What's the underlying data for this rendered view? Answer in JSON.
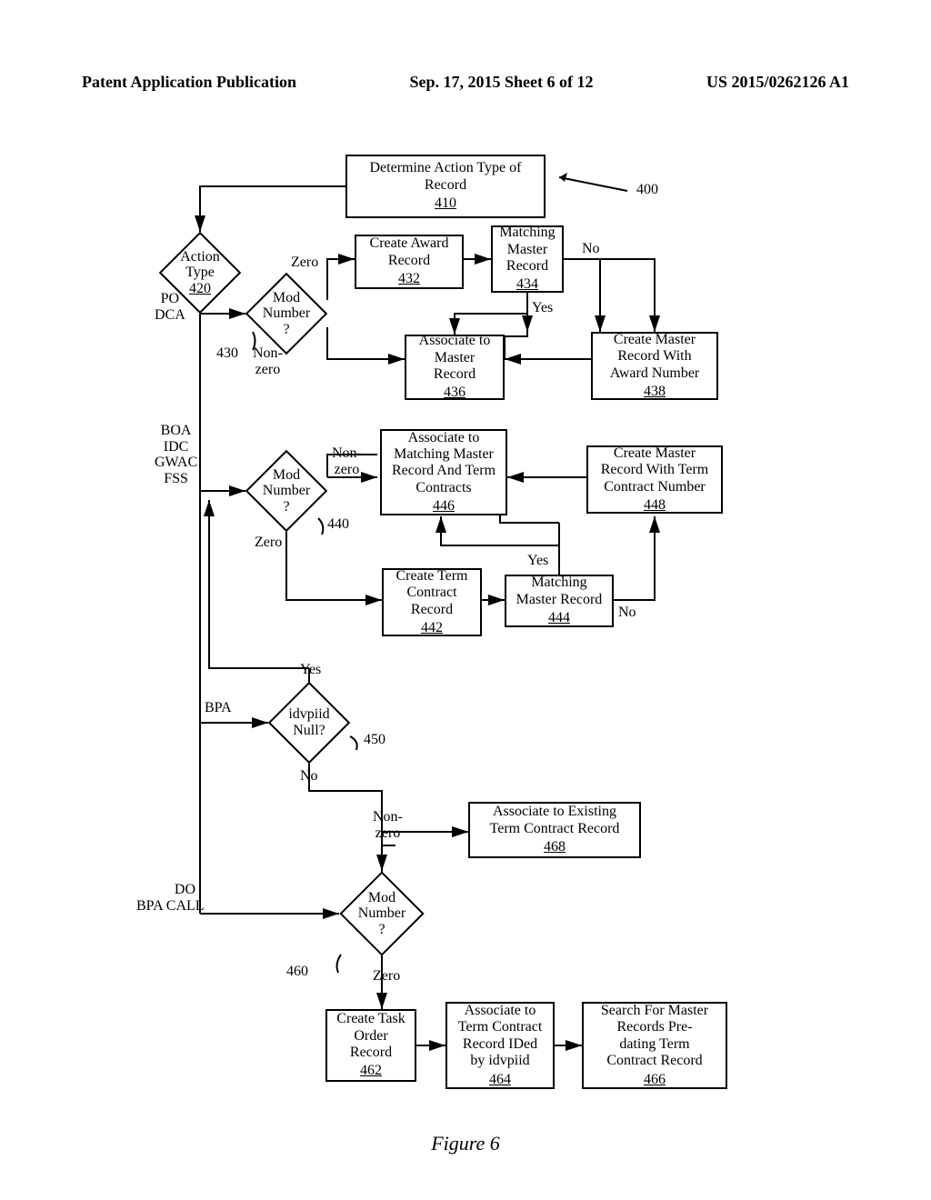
{
  "header": {
    "left": "Patent Application Publication",
    "center": "Sep. 17, 2015   Sheet 6 of 12",
    "right": "US 2015/0262126 A1"
  },
  "refs": {
    "n400": "400",
    "n410": "410",
    "n420": "420",
    "n430": "430",
    "n432": "432",
    "n434": "434",
    "n436": "436",
    "n438": "438",
    "n440": "440",
    "n442": "442",
    "n444": "444",
    "n446": "446",
    "n448": "448",
    "n450": "450",
    "n460": "460",
    "n462": "462",
    "n464": "464",
    "n466": "466",
    "n468": "468"
  },
  "boxes": {
    "b410": {
      "text": "Determine Action Type of\nRecord"
    },
    "b432": {
      "text": "Create Award\nRecord"
    },
    "b434": {
      "text": "Matching\nMaster\nRecord"
    },
    "b436": {
      "text": "Associate to\nMaster\nRecord"
    },
    "b438": {
      "text": "Create Master\nRecord With\nAward Number"
    },
    "b442": {
      "text": "Create Term\nContract\nRecord"
    },
    "b444": {
      "text": "Matching\nMaster Record"
    },
    "b446": {
      "text": "Associate to\nMatching Master\nRecord And Term\nContracts"
    },
    "b448": {
      "text": "Create Master\nRecord With Term\nContract Number"
    },
    "b462": {
      "text": "Create Task\nOrder\nRecord"
    },
    "b464": {
      "text": "Associate to\nTerm Contract\nRecord IDed\nby idvpiid"
    },
    "b466": {
      "text": "Search For Master\nRecords Pre-\ndating Term\nContract Record"
    },
    "b468": {
      "text": "Associate to Existing\nTerm Contract Record"
    }
  },
  "diamonds": {
    "d420": "Action\nType",
    "d430": "Mod\nNumber\n?",
    "d440": "Mod\nNumber\n?",
    "d450": "idvpiid\nNull?",
    "d460": "Mod\nNumber\n?"
  },
  "edges": {
    "po_dca": "PO\nDCA",
    "boa_idc_gwac_fss": "BOA\nIDC\nGWAC\nFSS",
    "bpa": "BPA",
    "do_bpacall": "DO\nBPA CALL",
    "zero": "Zero",
    "nonzero": "Non-\nzero",
    "nonzero_inline": "Non-zero",
    "yes": "Yes",
    "no": "No"
  },
  "figure_caption": "Figure 6",
  "chart_data": {
    "type": "flowchart",
    "title": "Figure 6 — Determine Action Type of Record (process 400)",
    "nodes": [
      {
        "id": "410",
        "kind": "process",
        "text": "Determine Action Type of Record"
      },
      {
        "id": "420",
        "kind": "decision",
        "text": "Action Type"
      },
      {
        "id": "430",
        "kind": "decision",
        "text": "Mod Number ?"
      },
      {
        "id": "432",
        "kind": "process",
        "text": "Create Award Record"
      },
      {
        "id": "434",
        "kind": "process",
        "text": "Matching Master Record"
      },
      {
        "id": "436",
        "kind": "process",
        "text": "Associate to Master Record"
      },
      {
        "id": "438",
        "kind": "process",
        "text": "Create Master Record With Award Number"
      },
      {
        "id": "440",
        "kind": "decision",
        "text": "Mod Number ?"
      },
      {
        "id": "442",
        "kind": "process",
        "text": "Create Term Contract Record"
      },
      {
        "id": "444",
        "kind": "process",
        "text": "Matching Master Record"
      },
      {
        "id": "446",
        "kind": "process",
        "text": "Associate to Matching Master Record And Term Contracts"
      },
      {
        "id": "448",
        "kind": "process",
        "text": "Create Master Record With Term Contract Number"
      },
      {
        "id": "450",
        "kind": "decision",
        "text": "idvpiid Null?"
      },
      {
        "id": "460",
        "kind": "decision",
        "text": "Mod Number ?"
      },
      {
        "id": "462",
        "kind": "process",
        "text": "Create Task Order Record"
      },
      {
        "id": "464",
        "kind": "process",
        "text": "Associate to Term Contract Record IDed by idvpiid"
      },
      {
        "id": "466",
        "kind": "process",
        "text": "Search For Master Records Pre-dating Term Contract Record"
      },
      {
        "id": "468",
        "kind": "process",
        "text": "Associate to Existing Term Contract Record"
      }
    ],
    "edges": [
      {
        "from": "410",
        "to": "420",
        "label": ""
      },
      {
        "from": "420",
        "to": "430",
        "label": "PO / DCA"
      },
      {
        "from": "420",
        "to": "440",
        "label": "BOA / IDC / GWAC / FSS"
      },
      {
        "from": "420",
        "to": "450",
        "label": "BPA"
      },
      {
        "from": "420",
        "to": "460",
        "label": "DO / BPA CALL"
      },
      {
        "from": "430",
        "to": "432",
        "label": "Zero"
      },
      {
        "from": "430",
        "to": "436",
        "label": "Non-zero"
      },
      {
        "from": "432",
        "to": "434",
        "label": ""
      },
      {
        "from": "434",
        "to": "438",
        "label": "No"
      },
      {
        "from": "434",
        "to": "436",
        "label": "Yes"
      },
      {
        "from": "438",
        "to": "436",
        "label": ""
      },
      {
        "from": "440",
        "to": "442",
        "label": "Zero"
      },
      {
        "from": "440",
        "to": "446",
        "label": "Non-zero"
      },
      {
        "from": "442",
        "to": "444",
        "label": ""
      },
      {
        "from": "444",
        "to": "446",
        "label": "Yes"
      },
      {
        "from": "444",
        "to": "448",
        "label": "No"
      },
      {
        "from": "448",
        "to": "446",
        "label": ""
      },
      {
        "from": "450",
        "to": "440",
        "label": "Yes"
      },
      {
        "from": "450",
        "to": "460",
        "label": "No"
      },
      {
        "from": "460",
        "to": "462",
        "label": "Zero"
      },
      {
        "from": "460",
        "to": "468",
        "label": "Non-Zero"
      },
      {
        "from": "462",
        "to": "464",
        "label": ""
      },
      {
        "from": "464",
        "to": "466",
        "label": ""
      }
    ]
  }
}
